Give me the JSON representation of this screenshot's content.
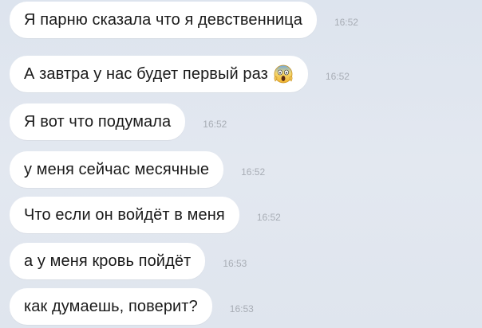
{
  "chat": {
    "messages": [
      {
        "text": "Я парню сказала что я девственница",
        "time": "16:52",
        "emoji": null
      },
      {
        "text": "А завтра у нас будет первый раз",
        "time": "16:52",
        "emoji": "scream-emoji-icon"
      },
      {
        "text": "Я вот что подумала",
        "time": "16:52",
        "emoji": null
      },
      {
        "text": "у меня сейчас месячные",
        "time": "16:52",
        "emoji": null
      },
      {
        "text": "Что если он войдёт в меня",
        "time": "16:52",
        "emoji": null
      },
      {
        "text": "а у меня кровь пойдёт",
        "time": "16:53",
        "emoji": null
      },
      {
        "text": "как думаешь, поверит?",
        "time": "16:53",
        "emoji": null
      }
    ]
  },
  "colors": {
    "background": "#dfe5ee",
    "bubble": "#ffffff",
    "text": "#1a1a1a",
    "timestamp": "#a8adb5"
  }
}
